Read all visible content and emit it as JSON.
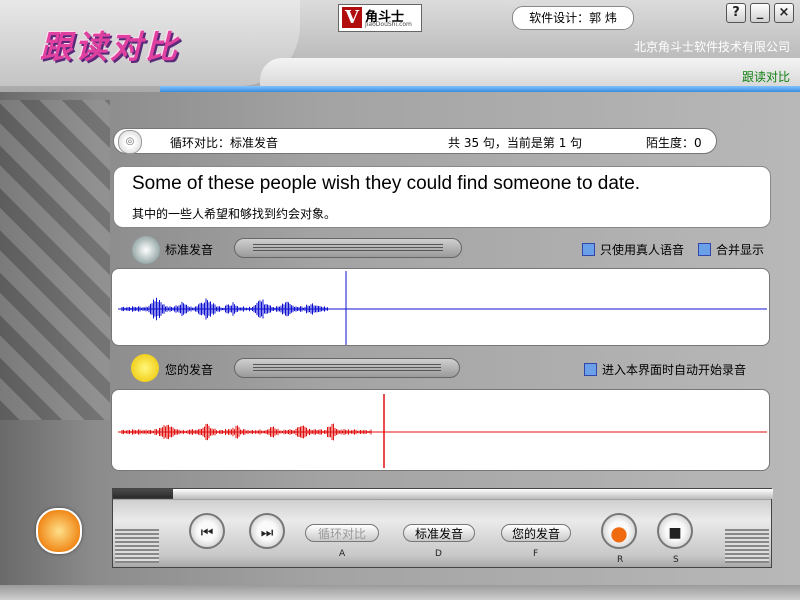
{
  "header": {
    "app_title": "跟读对比",
    "logo_mark": "V",
    "logo_text": "角斗士",
    "logo_sub": "JiaoDouShi.com",
    "designer": "软件设计：郭 炜",
    "company": "北京角斗士软件技术有限公司",
    "mode_label": "跟读对比",
    "window_buttons": [
      "?",
      "_",
      "×"
    ]
  },
  "status": {
    "loop_mode": "循环对比：标准发音",
    "sentence_count": "共 35 句，当前是第 1 句",
    "unfamiliarity": "陌生度：0"
  },
  "sentence": {
    "english": "Some of these people wish they could find someone to date.",
    "chinese": "其中的一些人希望和够找到约会对象。"
  },
  "standard": {
    "label": "标准发音",
    "use_real_voice": "只使用真人语音",
    "merge_display": "合并显示",
    "wave_color": "#1010d0"
  },
  "user": {
    "label": "您的发音",
    "auto_record": "进入本界面时自动开始录音",
    "wave_color": "#e01010"
  },
  "controls": {
    "prev": "⏮",
    "next": "⏭",
    "loop_compare": "循环对比",
    "standard_pron": "标准发音",
    "your_pron": "您的发音",
    "record": "●",
    "stop": "■",
    "keys": {
      "loop": "A",
      "standard": "D",
      "yours": "F",
      "record": "R",
      "stop": "S"
    }
  },
  "colors": {
    "accent_blue": "#3a8be0",
    "checkbox": "#6aa0e8",
    "record_orange": "#f06a10"
  }
}
